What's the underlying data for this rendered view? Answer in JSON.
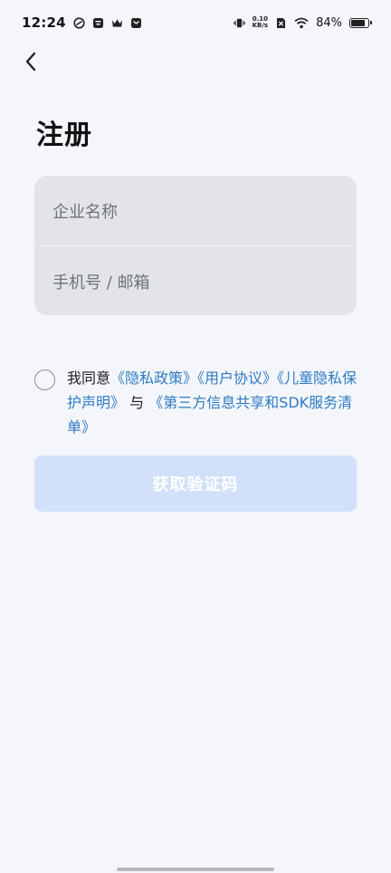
{
  "status_bar": {
    "time": "12:24",
    "net_speed_value": "0.10",
    "net_speed_unit": "KB/s",
    "battery_percent": "84%",
    "battery_level": 0.84,
    "icons": [
      "link-icon",
      "archive-icon",
      "crown-icon",
      "message-icon",
      "vibrate-icon",
      "no-sim-icon",
      "wifi-icon",
      "battery-icon"
    ]
  },
  "nav": {
    "back_icon": "chevron-left-icon"
  },
  "page": {
    "title": "注册"
  },
  "form": {
    "company_placeholder": "企业名称",
    "phone_email_placeholder": "手机号 / 邮箱"
  },
  "agreement": {
    "prefix": "我同意",
    "privacy_policy": "《隐私政策》",
    "user_agreement": "《用户协议》",
    "children_privacy": "《儿童隐私保护声明》",
    "connector": " 与 ",
    "third_party_sdk": "《第三方信息共享和SDK服务清单》"
  },
  "submit": {
    "label": "获取验证码"
  },
  "colors": {
    "background": "#f4f6fb",
    "input_bg": "#e2e4e9",
    "link": "#2e7bc4",
    "button_disabled": "#d2e1f9"
  }
}
